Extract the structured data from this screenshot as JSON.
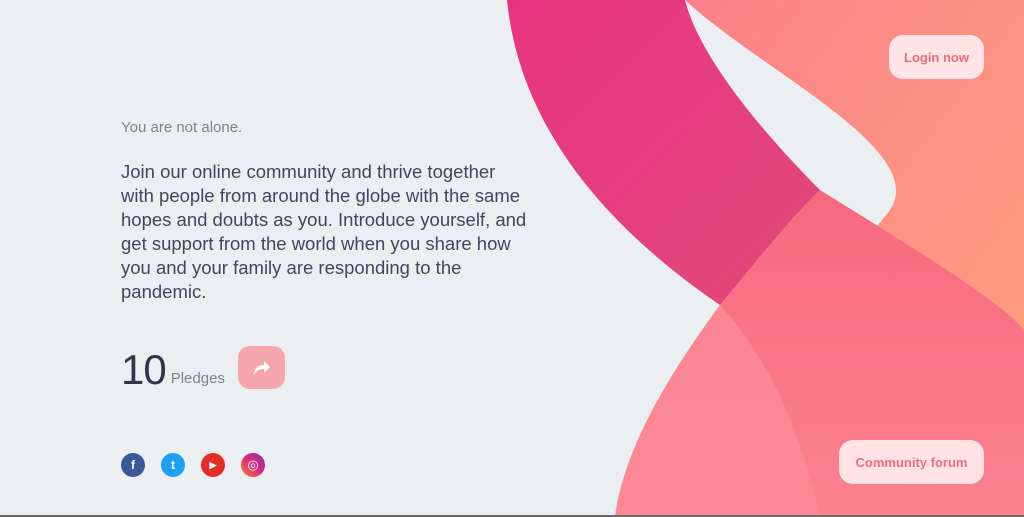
{
  "hero": {
    "tagline": "You are not alone.",
    "intro": "Join our online community and thrive together with people from around the globe with the same hopes and doubts as you. Introduce yourself, and get support from the world when you share how you and your family are responding to the pandemic."
  },
  "pledges": {
    "count": "10",
    "label": "Pledges",
    "share_icon": "share-arrow-icon"
  },
  "nav": {
    "login_label": "Login now",
    "forum_label": "Community forum"
  },
  "socials": [
    {
      "name": "facebook-icon",
      "glyph": "f",
      "color": "#3b5998"
    },
    {
      "name": "twitter-icon",
      "glyph": "t",
      "color": "#1da1f2"
    },
    {
      "name": "youtube-icon",
      "glyph": "▶",
      "color": "#e52d27"
    },
    {
      "name": "instagram-icon",
      "glyph": "◎",
      "color": "#c13584"
    }
  ],
  "colors": {
    "background": "#eceff1",
    "wave_magenta": "#e4357d",
    "wave_pink": "#f5637a",
    "wave_peach": "#ff9a7a",
    "accent_button": "#f6a5ad"
  }
}
